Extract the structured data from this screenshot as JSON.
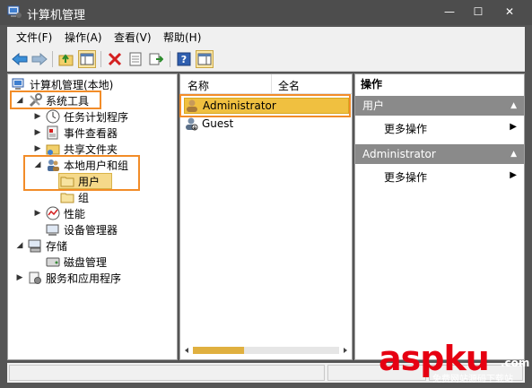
{
  "window": {
    "title": "计算机管理",
    "controls": {
      "minimize": "—",
      "maximize": "☐",
      "close": "✕"
    }
  },
  "menu": [
    {
      "label": "文件(F)"
    },
    {
      "label": "操作(A)"
    },
    {
      "label": "查看(V)"
    },
    {
      "label": "帮助(H)"
    }
  ],
  "toolbar": {
    "icons": [
      "back-icon",
      "forward-icon",
      "up-folder-icon",
      "show-tree-icon",
      "delete-icon",
      "properties-icon",
      "export-icon",
      "help-icon",
      "action-pane-icon"
    ]
  },
  "tree": {
    "root": "计算机管理(本地)",
    "system_tools": "系统工具",
    "task_scheduler": "任务计划程序",
    "event_viewer": "事件查看器",
    "shared_folders": "共享文件夹",
    "local_users_groups": "本地用户和组",
    "users": "用户",
    "groups": "组",
    "performance": "性能",
    "device_manager": "设备管理器",
    "storage": "存储",
    "disk_management": "磁盘管理",
    "services_apps": "服务和应用程序"
  },
  "list": {
    "columns": [
      "名称",
      "全名"
    ],
    "rows": [
      {
        "name": "Administrator",
        "selected": true
      },
      {
        "name": "Guest",
        "selected": false
      }
    ],
    "scroll_position": 0.35
  },
  "actions": {
    "header": "操作",
    "sections": [
      {
        "title": "用户",
        "item": "更多操作"
      },
      {
        "title": "Administrator",
        "item": "更多操作"
      }
    ]
  },
  "colors": {
    "highlight_border": "#f28c28",
    "selection": "#f0c040",
    "section_header": "#8a8a8a"
  },
  "watermark": {
    "brand": "aspku",
    "tld": ".com",
    "tagline": "免费网站源码下载站"
  }
}
